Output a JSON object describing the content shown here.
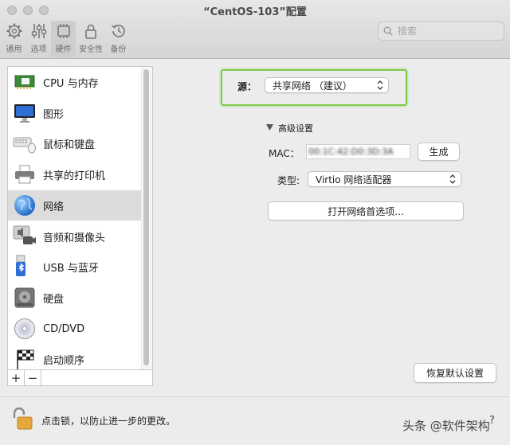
{
  "window": {
    "title": "“CentOS-103”配置"
  },
  "toolbar": {
    "items": [
      {
        "label": "通用",
        "icon": "gear-icon"
      },
      {
        "label": "选项",
        "icon": "sliders-icon"
      },
      {
        "label": "硬件",
        "icon": "chip-icon"
      },
      {
        "label": "安全性",
        "icon": "lock-icon"
      },
      {
        "label": "备份",
        "icon": "backup-icon"
      }
    ],
    "selected": "硬件"
  },
  "search": {
    "placeholder": "搜索"
  },
  "sidebar": {
    "items": [
      {
        "label": "CPU 与内存",
        "icon": "cpu-memory-icon"
      },
      {
        "label": "图形",
        "icon": "monitor-icon"
      },
      {
        "label": "鼠标和键盘",
        "icon": "keyboard-icon"
      },
      {
        "label": "共享的打印机",
        "icon": "printer-icon"
      },
      {
        "label": "网络",
        "icon": "globe-icon"
      },
      {
        "label": "音频和摄像头",
        "icon": "audio-camera-icon"
      },
      {
        "label": "USB 与蓝牙",
        "icon": "usb-bluetooth-icon"
      },
      {
        "label": "硬盘",
        "icon": "harddisk-icon"
      },
      {
        "label": "CD/DVD",
        "icon": "cd-icon"
      },
      {
        "label": "启动顺序",
        "icon": "boot-flag-icon"
      }
    ],
    "selected": "网络",
    "add_label": "+",
    "remove_label": "−"
  },
  "network": {
    "source_label": "源：",
    "source_value": "共享网络 （建议）",
    "advanced_label": "高级设置",
    "mac_label": "MAC：",
    "mac_value": "00:1C:42:D0:3D:3A",
    "generate_label": "生成",
    "type_label": "类型:",
    "type_value": "Virtio 网络适配器",
    "open_prefs_label": "打开网络首选项...",
    "restore_label": "恢复默认设置"
  },
  "footer": {
    "lock_text": "点击锁，以防止进一步的更改。",
    "watermark": "头条 @软件架构",
    "help_label": "?"
  },
  "colors": {
    "highlight_border": "#7fca4c",
    "selected_row": "#dcdcdc"
  }
}
